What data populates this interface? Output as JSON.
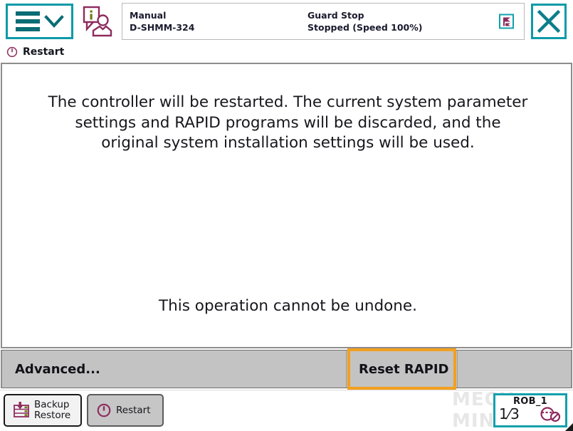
{
  "header": {
    "menu_icon": "hamburger-menu-icon",
    "menu_chevron_icon": "chevron-down-icon",
    "user_icon": "info-user-icon",
    "operating_mode": "Manual",
    "controller_name": "D-SHMM-324",
    "guard_state": "Guard Stop",
    "run_state": "Stopped (Speed 100%)",
    "opmode_icon": "flag-stop-icon",
    "close_icon": "close-icon"
  },
  "breadcrumb": {
    "icon": "restart-power-icon",
    "label": "Restart"
  },
  "content": {
    "message": "The controller will be restarted. The current system parameter settings and RAPID programs will be discarded, and the original system installation settings will be used.",
    "warning": "This operation cannot be undone."
  },
  "actionbar": {
    "advanced_label": "Advanced...",
    "reset_label": "Reset RAPID",
    "highlight_color": "#f2a01e"
  },
  "taskbar": {
    "buttons": [
      {
        "label_line1": "Backup",
        "label_line2": "Restore",
        "icon": "backup-restore-icon",
        "active": true
      },
      {
        "label_line1": "Restart",
        "label_line2": "",
        "icon": "restart-power-icon",
        "active": false
      }
    ],
    "robot": {
      "name": "ROB_1",
      "numerator": "1",
      "denominator": "3",
      "icon": "mechanical-unit-icon"
    },
    "watermark": "MECH MIND"
  },
  "colors": {
    "teal": "#0d9aa8",
    "maroon": "#8e2b5e",
    "orange": "#f2a01e",
    "bar_gray": "#c3c3c3"
  }
}
